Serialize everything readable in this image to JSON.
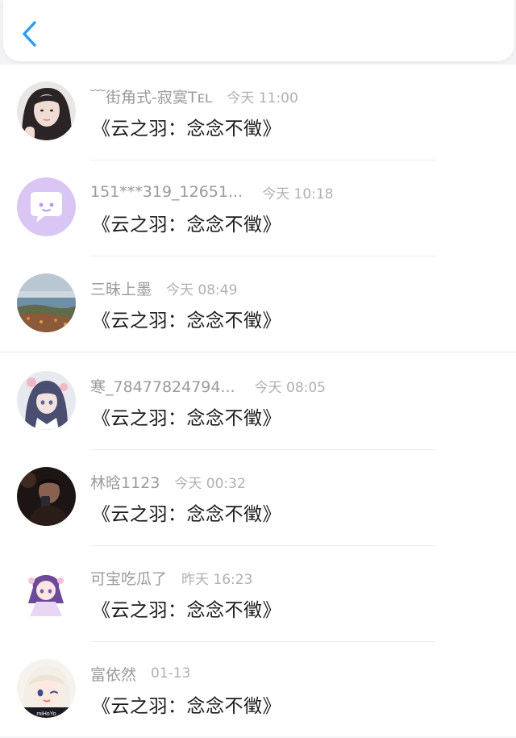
{
  "header": {
    "back_icon": "chevron-left-icon",
    "accent_color": "#2a9df4"
  },
  "messages": [
    {
      "name": "﹋街角式-寂寞Tᴇʟ",
      "time": "今天 11:00",
      "text": "《云之羽：念念不徵》",
      "avatar": "photo-girl-avatar"
    },
    {
      "name": "151***319_12651...",
      "time": "今天 10:18",
      "text": "《云之羽：念念不徵》",
      "avatar": "default-chat-bubble-avatar"
    },
    {
      "name": "三昧上墨",
      "time": "今天 08:49",
      "text": "《云之羽：念念不徵》",
      "avatar": "landscape-avatar"
    },
    {
      "name": "寒_78477824794...",
      "time": "今天 08:05",
      "text": "《云之羽：念念不徵》",
      "avatar": "anime-girl-avatar"
    },
    {
      "name": "林晗1123",
      "time": "今天 00:32",
      "text": "《云之羽：念念不徵》",
      "avatar": "dark-selfie-avatar"
    },
    {
      "name": "可宝吃瓜了",
      "time": "昨天 16:23",
      "text": "《云之羽：念念不徵》",
      "avatar": "anime-chibi-avatar"
    },
    {
      "name": "富依然",
      "time": "01-13",
      "text": "《云之羽：念念不徵》",
      "avatar": "paimon-avatar"
    }
  ],
  "paimon_watermark": "miHoYo"
}
